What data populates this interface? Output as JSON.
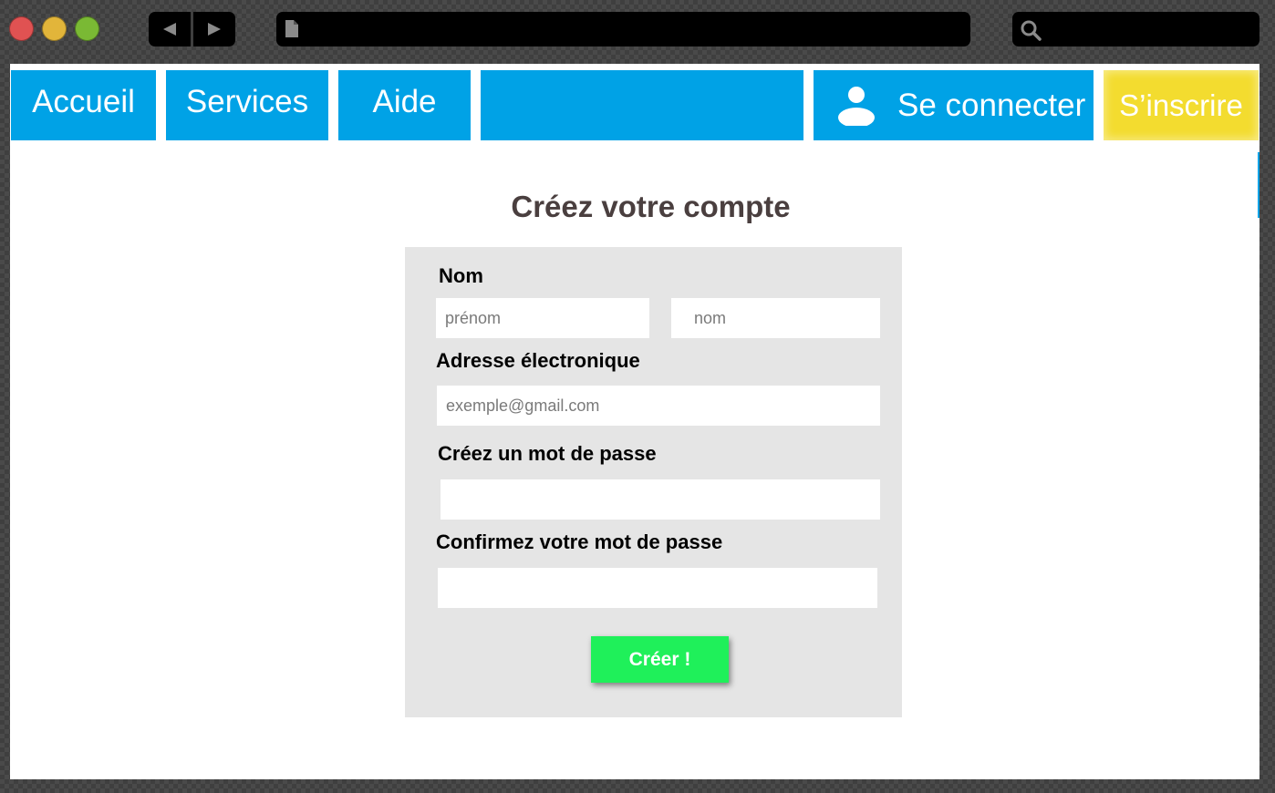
{
  "browser": {
    "back_icon": "back-arrow-icon",
    "forward_icon": "forward-arrow-icon",
    "url": "",
    "search": ""
  },
  "nav": {
    "items": [
      {
        "label": "Accueil"
      },
      {
        "label": "Services"
      },
      {
        "label": "Aide"
      }
    ],
    "login_label": "Se connecter",
    "login_icon": "user-icon",
    "signup_label": "S’inscrire",
    "colors": {
      "nav": "#00a2e6",
      "signup": "#f3dc2f"
    }
  },
  "form": {
    "title": "Créez votre compte",
    "name_label": "Nom",
    "first_name_placeholder": "prénom",
    "last_name_placeholder": "nom",
    "email_label": "Adresse électronique",
    "email_placeholder": "exemple@gmail.com",
    "password_label": "Créez un mot de passe",
    "confirm_label": "Confirmez votre mot de passe",
    "submit_label": "Créer !",
    "colors": {
      "submit": "#1ff05a",
      "panel": "#e5e5e5"
    }
  }
}
